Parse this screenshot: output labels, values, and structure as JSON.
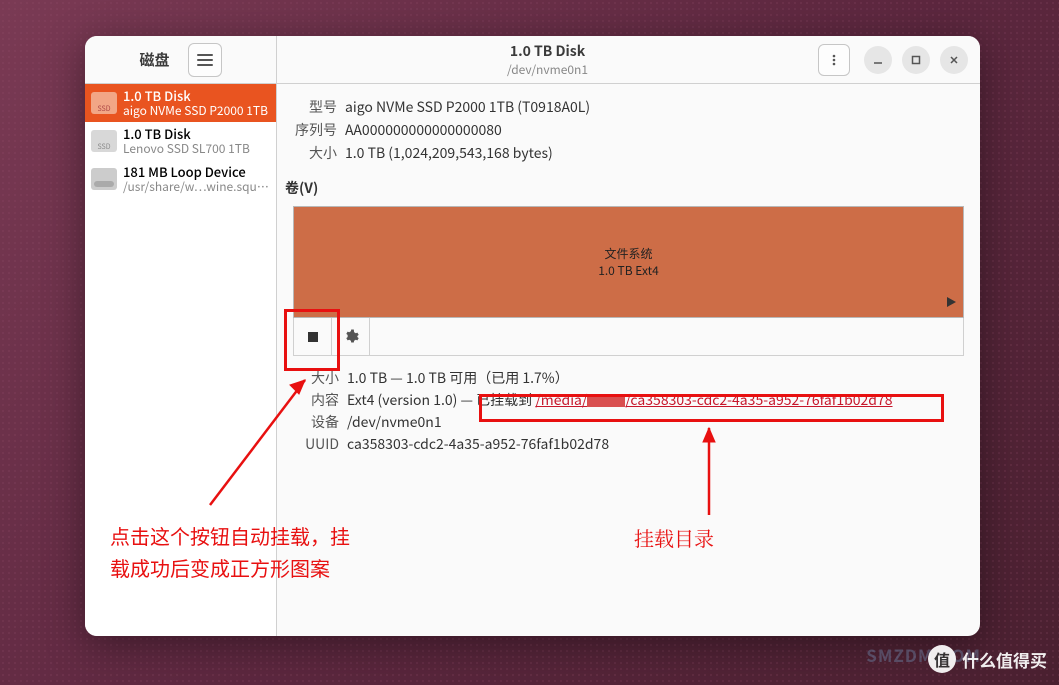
{
  "sidebar": {
    "title": "磁盘",
    "devices": [
      {
        "line1": "1.0 TB Disk",
        "line2": "aigo NVMe SSD P2000 1TB",
        "icon_label": "SSD",
        "selected": true,
        "type": "ssd"
      },
      {
        "line1": "1.0 TB Disk",
        "line2": "Lenovo SSD SL700 1TB",
        "icon_label": "SSD",
        "selected": false,
        "type": "ssd"
      },
      {
        "line1": "181 MB Loop Device",
        "line2": "/usr/share/w…wine.squashfs",
        "icon_label": "",
        "selected": false,
        "type": "loop"
      }
    ]
  },
  "header": {
    "title": "1.0 TB Disk",
    "subtitle": "/dev/nvme0n1"
  },
  "disk_info": {
    "model_label": "型号",
    "model_value": "aigo NVMe SSD P2000 1TB (T0918A0L)",
    "serial_label": "序列号",
    "serial_value": "AA000000000000000080",
    "size_label": "大小",
    "size_value": "1.0 TB (1,024,209,543,168 bytes)"
  },
  "volumes_section_label": "卷(V)",
  "volume": {
    "top_label": "文件系统",
    "bottom_label": "1.0 TB Ext4"
  },
  "partition_details": {
    "size_label": "大小",
    "size_value": "1.0 TB — 1.0 TB 可用（已用 1.7%）",
    "content_label": "内容",
    "content_prefix": "Ext4 (version 1.0) — ",
    "mounted_prefix": "已挂载到 ",
    "mount_path_pre": "/media/",
    "mount_path_post": "/ca358303-cdc2-4a35-a952-76faf1b02d78",
    "device_label": "设备",
    "device_value": "/dev/nvme0n1",
    "uuid_label": "UUID",
    "uuid_value": "ca358303-cdc2-4a35-a952-76faf1b02d78"
  },
  "annotations": {
    "left_text_l1": "点击这个按钮自动挂载，挂",
    "left_text_l2": "载成功后变成正方形图案",
    "right_text": "挂载目录"
  },
  "watermark": {
    "badge": "值",
    "text": "什么值得买",
    "ghost": "SMZDM.COM"
  }
}
